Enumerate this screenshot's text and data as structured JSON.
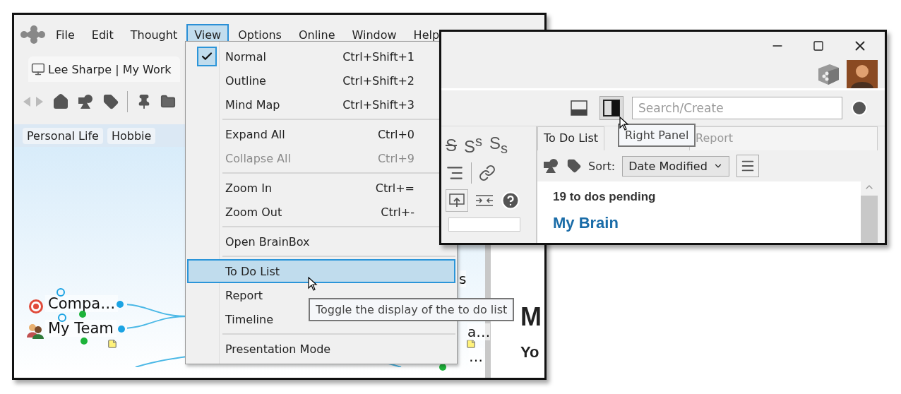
{
  "main_window": {
    "menu_bar": [
      {
        "label": "File",
        "selected": false
      },
      {
        "label": "Edit",
        "selected": false
      },
      {
        "label": "Thought",
        "selected": false
      },
      {
        "label": "View",
        "selected": true
      },
      {
        "label": "Options",
        "selected": false
      },
      {
        "label": "Online",
        "selected": false
      },
      {
        "label": "Window",
        "selected": false
      },
      {
        "label": "Help",
        "selected": false
      }
    ],
    "tab": {
      "label": "Lee Sharpe | My Work"
    },
    "pins": [
      {
        "label": "Personal Life"
      },
      {
        "label": "Hobbie"
      }
    ],
    "nodes": [
      {
        "label": "Compa…"
      },
      {
        "label": "My Team"
      }
    ],
    "map_fragments": [
      {
        "label": "s"
      },
      {
        "label": "a…"
      },
      {
        "label": "…"
      }
    ],
    "panel_texts": [
      {
        "label": "M"
      },
      {
        "label": "Yo"
      }
    ]
  },
  "view_menu": {
    "items": [
      {
        "kind": "item",
        "label": "Normal",
        "shortcut": "Ctrl+Shift+1",
        "checked": true,
        "disabled": false,
        "selected": false
      },
      {
        "kind": "item",
        "label": "Outline",
        "shortcut": "Ctrl+Shift+2",
        "checked": false,
        "disabled": false,
        "selected": false
      },
      {
        "kind": "item",
        "label": "Mind Map",
        "shortcut": "Ctrl+Shift+3",
        "checked": false,
        "disabled": false,
        "selected": false
      },
      {
        "kind": "separator"
      },
      {
        "kind": "item",
        "label": "Expand All",
        "shortcut": "Ctrl+0",
        "checked": false,
        "disabled": false,
        "selected": false
      },
      {
        "kind": "item",
        "label": "Collapse All",
        "shortcut": "Ctrl+9",
        "checked": false,
        "disabled": true,
        "selected": false
      },
      {
        "kind": "separator"
      },
      {
        "kind": "item",
        "label": "Zoom In",
        "shortcut": "Ctrl+=",
        "checked": false,
        "disabled": false,
        "selected": false
      },
      {
        "kind": "item",
        "label": "Zoom Out",
        "shortcut": "Ctrl+-",
        "checked": false,
        "disabled": false,
        "selected": false
      },
      {
        "kind": "separator"
      },
      {
        "kind": "item",
        "label": "Open BrainBox",
        "checked": false,
        "disabled": false,
        "selected": false
      },
      {
        "kind": "separator"
      },
      {
        "kind": "item",
        "label": "To Do List",
        "checked": false,
        "disabled": false,
        "selected": true
      },
      {
        "kind": "item",
        "label": "Report",
        "checked": false,
        "disabled": false,
        "selected": false
      },
      {
        "kind": "item",
        "label": "Timeline",
        "checked": false,
        "disabled": false,
        "selected": false
      },
      {
        "kind": "separator"
      },
      {
        "kind": "item",
        "label": "Presentation Mode",
        "checked": false,
        "disabled": false,
        "selected": false
      }
    ]
  },
  "menu_tooltip": "Toggle the display of the to do list",
  "side_window": {
    "panel_buttons": [
      {
        "kind": "bottom",
        "selected": false
      },
      {
        "kind": "right",
        "selected": true
      }
    ],
    "search": {
      "placeholder": "Search/Create"
    },
    "panel_tooltip": "Right Panel",
    "format_buttons": [
      {
        "kind": "strike",
        "label": "S"
      },
      {
        "kind": "plain",
        "label": "S$^{s}$"
      },
      {
        "kind": "plain",
        "label": "S$_{s}$"
      }
    ],
    "tabs": [
      {
        "label": "To Do List",
        "selected": true
      },
      {
        "label": "Report",
        "selected": false
      }
    ],
    "sort": {
      "label": "Sort:",
      "value": "Date Modified"
    },
    "pending": "19 to dos pending",
    "heading": "My Brain"
  }
}
